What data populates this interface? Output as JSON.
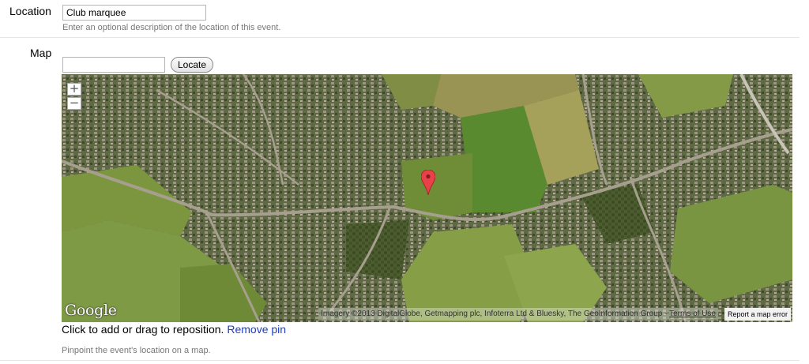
{
  "location": {
    "label": "Location",
    "value": "Club marquee",
    "help": "Enter an optional description of the location of this event."
  },
  "map": {
    "label": "Map",
    "search_value": "",
    "locate_label": "Locate",
    "zoom_in": "+",
    "zoom_out": "−",
    "logo": "Google",
    "attribution": "Imagery ©2013 DigitalGlobe, Getmapping plc, Infoterra Ltd & Bluesky, The GeoInformation Group -",
    "terms": "Terms of Use",
    "report": "Report a map error",
    "hint": "Click to add or drag to reposition.",
    "remove_pin": "Remove pin",
    "help": "Pinpoint the event's location on a map."
  },
  "colors": {
    "link": "#1a3cc8",
    "pin": "#e8414a",
    "field_green": "#6f8a3a",
    "urban": "#7a7a6a"
  }
}
